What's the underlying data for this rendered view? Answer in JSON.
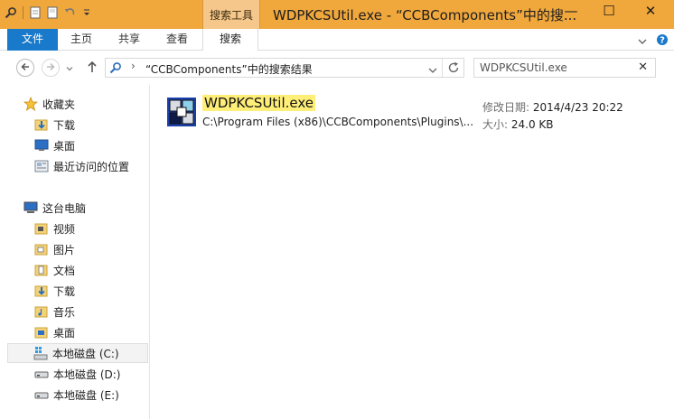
{
  "titlebar": {
    "context_tab": "搜索工具",
    "title": "WDPKCSUtil.exe - “CCBComponents”中的搜...",
    "minimize": "—",
    "maximize": "☐",
    "close": "✕",
    "color": "#f0a73c"
  },
  "ribbon": {
    "file": "文件",
    "home": "主页",
    "share": "共享",
    "view": "查看",
    "search": "搜索",
    "expand_icon": "chevron-down",
    "help_icon": "help"
  },
  "address": {
    "path": "“CCBComponents”中的搜索结果",
    "search_value": "WDPKCSUtil.exe"
  },
  "sidebar": {
    "favorites": "收藏夹",
    "fav_items": [
      "下载",
      "桌面",
      "最近访问的位置"
    ],
    "this_pc": "这台电脑",
    "pc_items": [
      "视频",
      "图片",
      "文档",
      "下载",
      "音乐",
      "桌面"
    ],
    "drives": [
      "本地磁盘 (C:)",
      "本地磁盘 (D:)",
      "本地磁盘 (E:)"
    ]
  },
  "result": {
    "name": "WDPKCSUtil.exe",
    "path": "C:\\Program Files (x86)\\CCBComponents\\Plugins\\...",
    "date_label": "修改日期:",
    "date": "2014/4/23 20:22",
    "size_label": "大小:",
    "size": "24.0 KB"
  },
  "colors": {
    "file_tab": "#1979ca",
    "highlight": "#ffee78"
  }
}
